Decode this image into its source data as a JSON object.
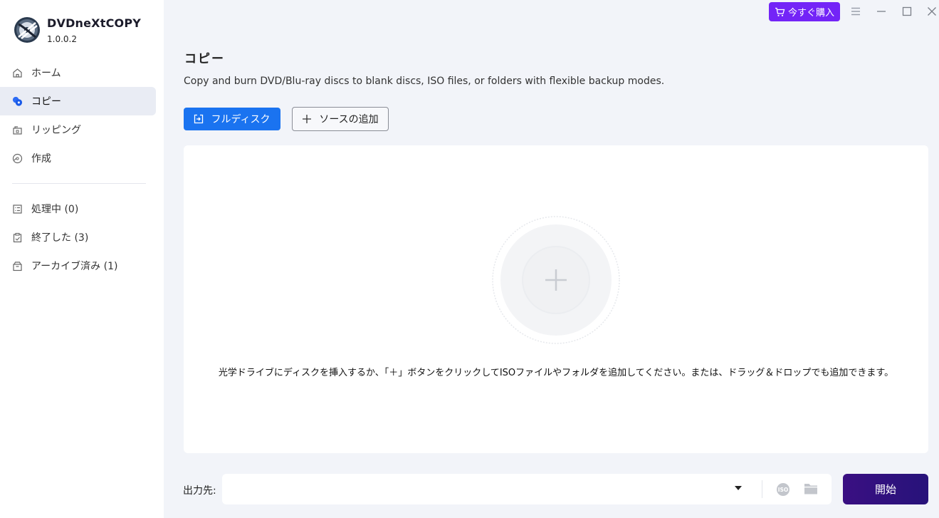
{
  "app": {
    "name": "DVDneXtCOPY",
    "version": "1.0.0.2"
  },
  "sidebar": {
    "items": [
      {
        "label": "ホーム",
        "icon": "home-icon"
      },
      {
        "label": "コピー",
        "icon": "copy-icon",
        "active": true
      },
      {
        "label": "リッピング",
        "icon": "ripping-icon"
      },
      {
        "label": "作成",
        "icon": "create-icon"
      }
    ],
    "queue_items": [
      {
        "label": "処理中 (0)",
        "icon": "processing-icon"
      },
      {
        "label": "終了した (3)",
        "icon": "finished-icon"
      },
      {
        "label": "アーカイブ済み (1)",
        "icon": "archive-icon"
      }
    ]
  },
  "titlebar": {
    "buy_label": "今すぐ購入"
  },
  "main": {
    "title": "コピー",
    "description": "Copy and burn DVD/Blu-ray discs to blank discs, ISO files, or folders with flexible backup modes.",
    "full_disc_label": "フルディスク",
    "add_source_label": "ソースの追加",
    "drop_hint": "光学ドライブにディスクを挿入するか、「＋」ボタンをクリックしてISOファイルやフォルダを追加してください。または、ドラッグ＆ドロップでも追加できます。",
    "output_label": "出力先:",
    "output_value": "",
    "start_label": "開始"
  },
  "colors": {
    "accent_blue": "#1a73f0",
    "buy_purple": "#7324f7",
    "start_dark_purple": "#2f1280",
    "background": "#f2f4f9"
  }
}
